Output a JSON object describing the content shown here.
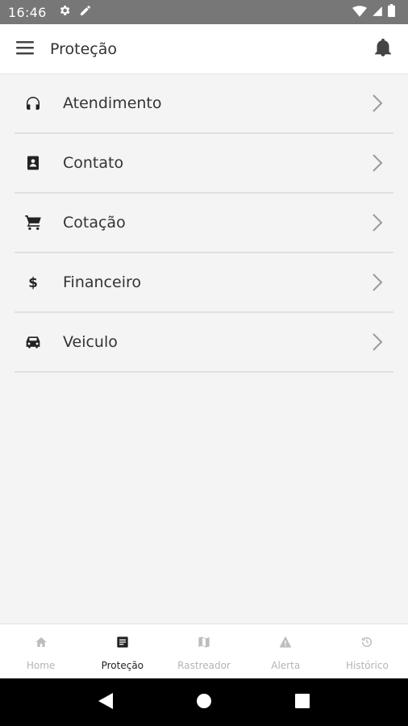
{
  "status_bar": {
    "time": "16:46"
  },
  "app_bar": {
    "title": "Proteção"
  },
  "list": [
    {
      "label": "Atendimento",
      "icon": "headset-icon"
    },
    {
      "label": "Contato",
      "icon": "contact-book-icon"
    },
    {
      "label": "Cotação",
      "icon": "cart-icon"
    },
    {
      "label": "Financeiro",
      "icon": "dollar-icon"
    },
    {
      "label": "Veiculo",
      "icon": "car-icon"
    }
  ],
  "bottom_nav": [
    {
      "label": "Home",
      "icon": "home-icon",
      "active": false
    },
    {
      "label": "Proteção",
      "icon": "document-icon",
      "active": true
    },
    {
      "label": "Rastreador",
      "icon": "map-icon",
      "active": false
    },
    {
      "label": "Alerta",
      "icon": "warning-icon",
      "active": false
    },
    {
      "label": "Histórico",
      "icon": "history-icon",
      "active": false
    }
  ],
  "colors": {
    "status_bar": "#777777",
    "background": "#f4f4f4",
    "active_nav": "#222222",
    "inactive_nav": "#b4b4b4"
  }
}
